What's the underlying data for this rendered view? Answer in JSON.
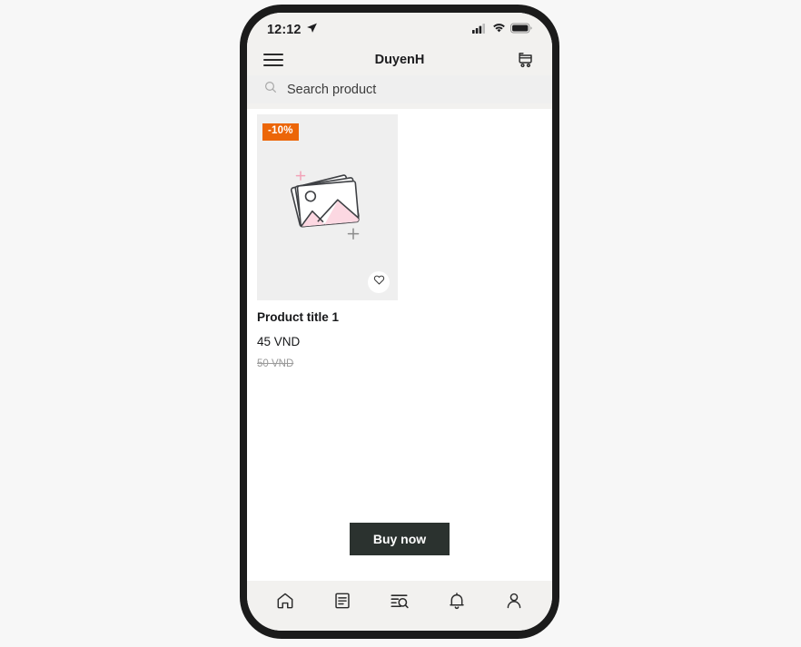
{
  "status_bar": {
    "time": "12:12",
    "location_icon": "location-arrow-icon",
    "signal_icon": "cellular-signal-icon",
    "wifi_icon": "wifi-icon",
    "battery_icon": "battery-full-icon"
  },
  "header": {
    "menu_icon": "hamburger-menu-icon",
    "title": "DuyenH",
    "cart_icon": "shopping-cart-icon"
  },
  "search": {
    "icon": "search-icon",
    "placeholder": "Search product",
    "value": ""
  },
  "product": {
    "discount_badge": "-10%",
    "placeholder_icon": "image-placeholder-icon",
    "favorite_icon": "heart-outline-icon",
    "title": "Product title 1",
    "price": "45 VND",
    "old_price": "50 VND"
  },
  "actions": {
    "buy_now_label": "Buy now"
  },
  "bottom_nav": [
    {
      "name": "home",
      "icon": "home-icon"
    },
    {
      "name": "orders",
      "icon": "document-lines-icon"
    },
    {
      "name": "search-orders",
      "icon": "document-search-icon"
    },
    {
      "name": "notifications",
      "icon": "bell-icon"
    },
    {
      "name": "account",
      "icon": "person-icon"
    }
  ],
  "colors": {
    "accent_orange": "#ec6608",
    "button_dark": "#2b322f",
    "chrome": "#f2f1ef",
    "media_bg": "#efefef",
    "illustration_pink": "#fcd8e2",
    "page_bg": "#f7f7f7"
  }
}
